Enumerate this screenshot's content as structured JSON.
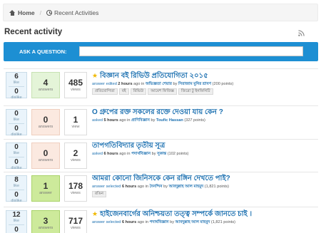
{
  "breadcrumb": {
    "home": "Home",
    "current": "Recent Activities"
  },
  "page_title": "Recent activity",
  "ask": {
    "label": "ASK A QUESTION:",
    "value": ""
  },
  "questions": [
    {
      "likes": "6",
      "likes_label": "like",
      "dislikes": "0",
      "dislikes_label": "dislike",
      "answers": "4",
      "answers_label": "answers",
      "views": "485",
      "views_label": "views",
      "answer_state": "some",
      "starred": true,
      "title": "বিজ্ঞান বই রিভিউ প্রতিযোগিতা ২০১৫",
      "action": "answer edited",
      "when": "2 hours",
      "ago_in": "ago in",
      "category": "অভিজ্ঞতা শেয়ার",
      "by": "by",
      "user": "সিরাজাম মুনির শ্রাবণ",
      "points": "(200 points)",
      "tags": [
        "প্রতিযোগিতা",
        "বই",
        "রিভিউ",
        "আয়েশ ফিজিক্স",
        "জিরো টু ইনফিনিটি"
      ]
    },
    {
      "likes": "0",
      "likes_label": "like",
      "dislikes": "0",
      "dislikes_label": "dislike",
      "answers": "0",
      "answers_label": "answers",
      "views": "1",
      "views_label": "view",
      "answer_state": "zero",
      "starred": false,
      "title": "O গ্রুপের রক্ত সকলের রক্তে দেওয়া যায় কেন ?",
      "action": "asked",
      "when": "5 hours",
      "ago_in": "ago in",
      "category": "প্রাণিবিজ্ঞান",
      "by": "by",
      "user": "Toufic Hassan",
      "points": "(327 points)",
      "tags": []
    },
    {
      "likes": "0",
      "likes_label": "like",
      "dislikes": "0",
      "dislikes_label": "dislike",
      "answers": "0",
      "answers_label": "answers",
      "views": "2",
      "views_label": "views",
      "answer_state": "zero",
      "starred": false,
      "title": "তাপগতিবিদ্যার তৃতীয় সূত্র",
      "action": "asked",
      "when": "6 hours",
      "ago_in": "ago in",
      "category": "পদার্থবিজ্ঞান",
      "by": "by",
      "user": "সুকান্ত",
      "points": "(102 points)",
      "tags": []
    },
    {
      "likes": "8",
      "likes_label": "like",
      "dislikes": "0",
      "dislikes_label": "dislike",
      "answers": "1",
      "answers_label": "answer",
      "views": "178",
      "views_label": "views",
      "answer_state": "selected",
      "starred": false,
      "title": "আমরা কোনো জিনিসকে কেন রঙ্গিন দেখতে পাই?",
      "action": "answer selected",
      "when": "6 hours",
      "ago_in": "ago in",
      "category": "দৈনন্দিন",
      "by": "by",
      "user": "আবদুল্লাহ আল মাহমুদ",
      "points": "(1,821 points)",
      "tags": [
        "রঙিন"
      ]
    },
    {
      "likes": "12",
      "likes_label": "like",
      "dislikes": "0",
      "dislikes_label": "dislike",
      "answers": "3",
      "answers_label": "answers",
      "views": "717",
      "views_label": "views",
      "answer_state": "selected",
      "starred": true,
      "title": "হাইজেনবার্গের  অনিশ্চয়তা তত্ত্ব সম্পর্কে জানতে চাই ।",
      "action": "answer selected",
      "when": "6 hours",
      "ago_in": "ago in",
      "category": "পদার্থবিজ্ঞান",
      "by": "by",
      "user": "আবদুল্লাহ আল মাহমুদ",
      "points": "(1,821 points)",
      "tags": []
    }
  ]
}
